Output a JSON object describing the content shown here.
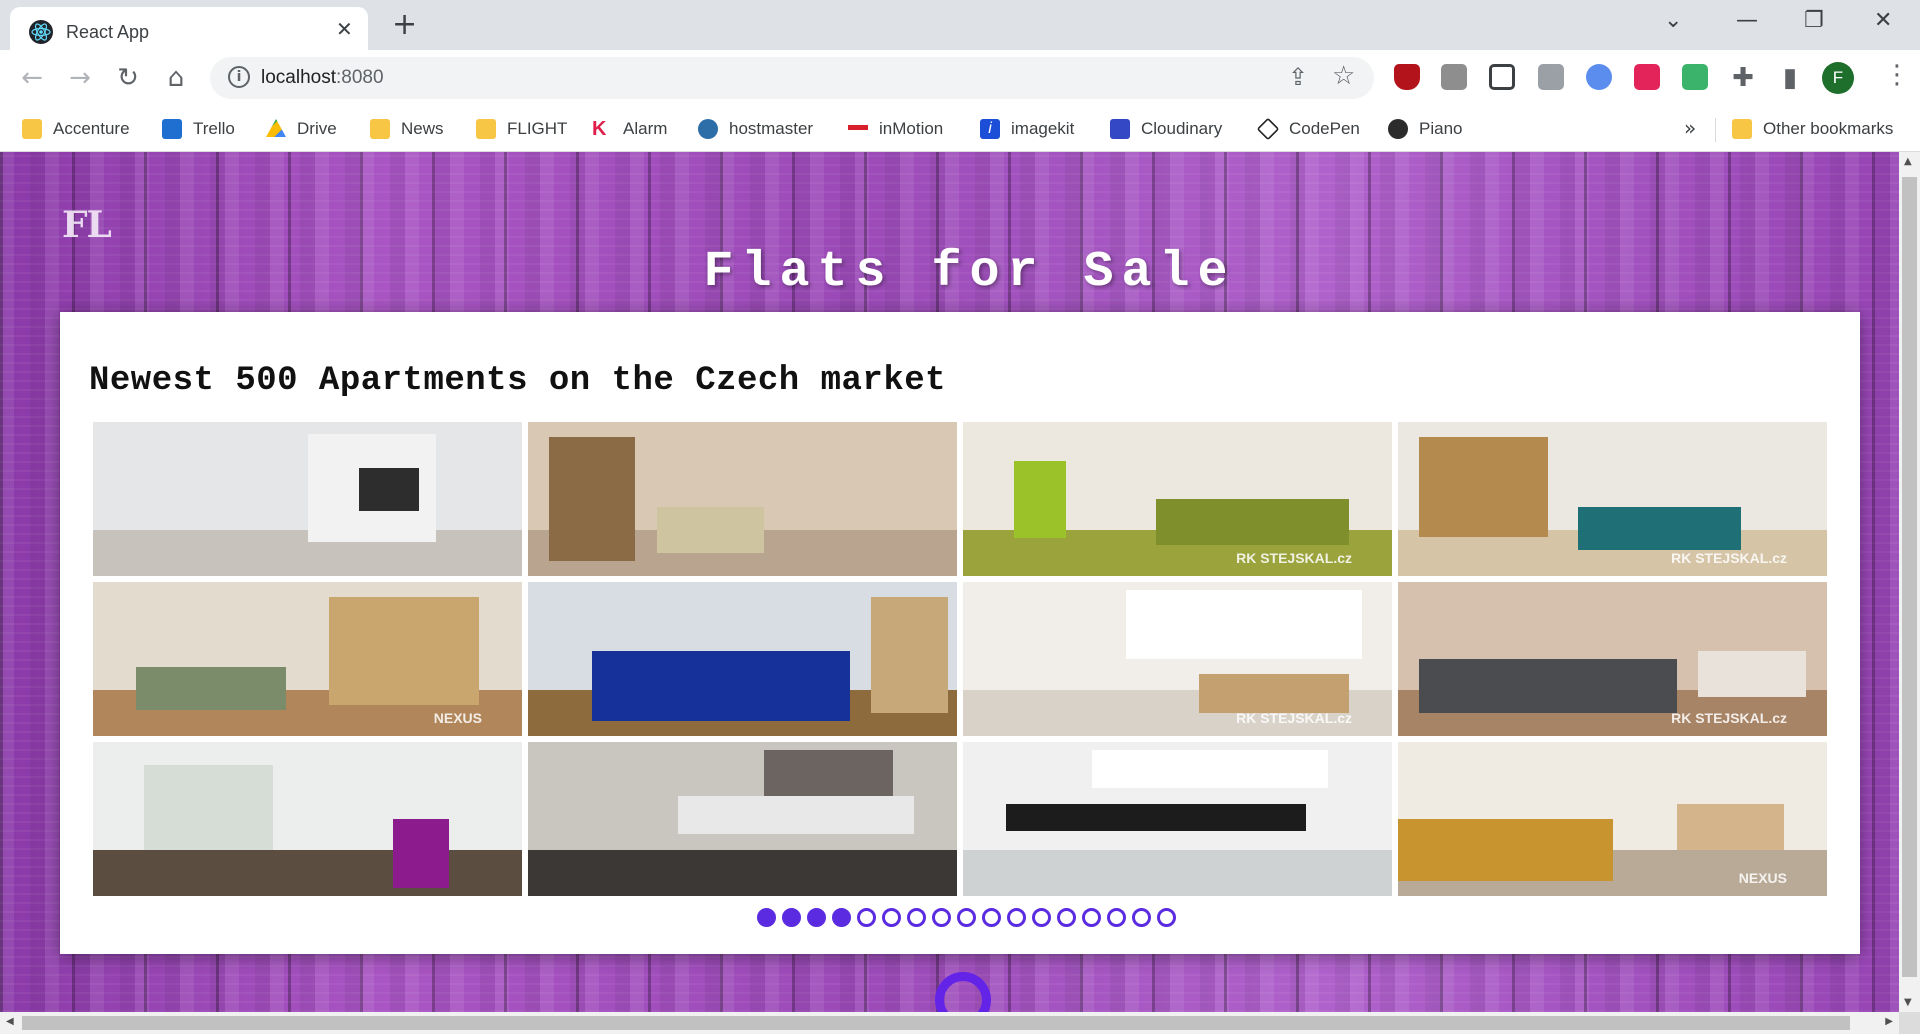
{
  "browser": {
    "tab_title": "React App",
    "tab_close": "✕",
    "new_tab": "+",
    "window_controls": {
      "minimize": "—",
      "restore": "❐",
      "close": "✕",
      "tab_search": "⌄"
    },
    "url_host": "localhost",
    "url_port": ":8080",
    "profile_initial": "F",
    "bookmarks": [
      {
        "label": "Accenture",
        "icon": "folder-icon"
      },
      {
        "label": "Trello",
        "icon": "trello-icon"
      },
      {
        "label": "Drive",
        "icon": "drive-icon"
      },
      {
        "label": "News",
        "icon": "folder-icon"
      },
      {
        "label": "FLIGHT",
        "icon": "folder-icon"
      },
      {
        "label": "Alarm",
        "icon": "alarm-k-icon"
      },
      {
        "label": "hostmaster",
        "icon": "hostmaster-icon"
      },
      {
        "label": "inMotion",
        "icon": "inmotion-icon"
      },
      {
        "label": "imagekit",
        "icon": "imagekit-icon"
      },
      {
        "label": "Cloudinary",
        "icon": "cloudinary-icon"
      },
      {
        "label": "CodePen",
        "icon": "codepen-icon"
      },
      {
        "label": "Piano",
        "icon": "piano-icon"
      }
    ],
    "bookmarks_more": "»",
    "other_bookmarks": "Other bookmarks"
  },
  "page": {
    "logo": "FL",
    "title": "Flats for Sale",
    "heading": "Newest 500 Apartments on the Czech market",
    "photos": [
      {
        "name": "kitchen-white",
        "wall": "#e4e6e8",
        "floor": "#c7c2bb",
        "obj1": "#f2f2f2",
        "obj2": "#2d2d2d",
        "watermark": ""
      },
      {
        "name": "living-room-cabinet",
        "wall": "#d9c9b4",
        "floor": "#b9a58f",
        "obj1": "#8a6b45",
        "obj2": "#cfc4a0",
        "watermark": ""
      },
      {
        "name": "living-green-sofa",
        "wall": "#ece8df",
        "floor": "#9aa33c",
        "obj1": "#9cc22a",
        "obj2": "#7e8f2c",
        "watermark": "RK STEJSKAL.cz"
      },
      {
        "name": "living-teal-sofa",
        "wall": "#ebe8e2",
        "floor": "#d5c4a6",
        "obj1": "#1f6f76",
        "obj2": "#b58a4f",
        "watermark": "RK STEJSKAL.cz"
      },
      {
        "name": "attic-living",
        "wall": "#e4dbcf",
        "floor": "#b0865a",
        "obj1": "#7a8c6a",
        "obj2": "#c9a66e",
        "watermark": "NEXUS"
      },
      {
        "name": "bedroom-blue-sofa",
        "wall": "#d8dde3",
        "floor": "#8e6b3c",
        "obj1": "#16329a",
        "obj2": "#c7a878",
        "watermark": ""
      },
      {
        "name": "bright-living-kitchen",
        "wall": "#f1eee9",
        "floor": "#d8d2c9",
        "obj1": "#ffffff",
        "obj2": "#c4a070",
        "watermark": "RK STEJSKAL.cz"
      },
      {
        "name": "grey-sofa-living",
        "wall": "#d6c1ae",
        "floor": "#a88466",
        "obj1": "#4a4c50",
        "obj2": "#e8e2da",
        "watermark": "RK STEJSKAL.cz"
      },
      {
        "name": "empty-room-windows",
        "wall": "#eceded",
        "floor": "#5b4d3f",
        "obj1": "#d6dcd6",
        "obj2": "#8c1b8e",
        "watermark": ""
      },
      {
        "name": "kitchen-tiles",
        "wall": "#c9c6c0",
        "floor": "#3b3836",
        "obj1": "#e8e8e8",
        "obj2": "#6b6460",
        "watermark": ""
      },
      {
        "name": "kitchen-black-counter",
        "wall": "#f0f0f0",
        "floor": "#cfd2d3",
        "obj1": "#1c1c1c",
        "obj2": "#ffffff",
        "watermark": ""
      },
      {
        "name": "mustard-sofa-living",
        "wall": "#efeae2",
        "floor": "#b9aa98",
        "obj1": "#c8942f",
        "obj2": "#d4b48a",
        "watermark": "NEXUS"
      }
    ],
    "pagination": {
      "total": 17,
      "active": 4
    }
  },
  "colors": {
    "accent": "#5a2be0",
    "bottom_icon": "#6424e8"
  }
}
